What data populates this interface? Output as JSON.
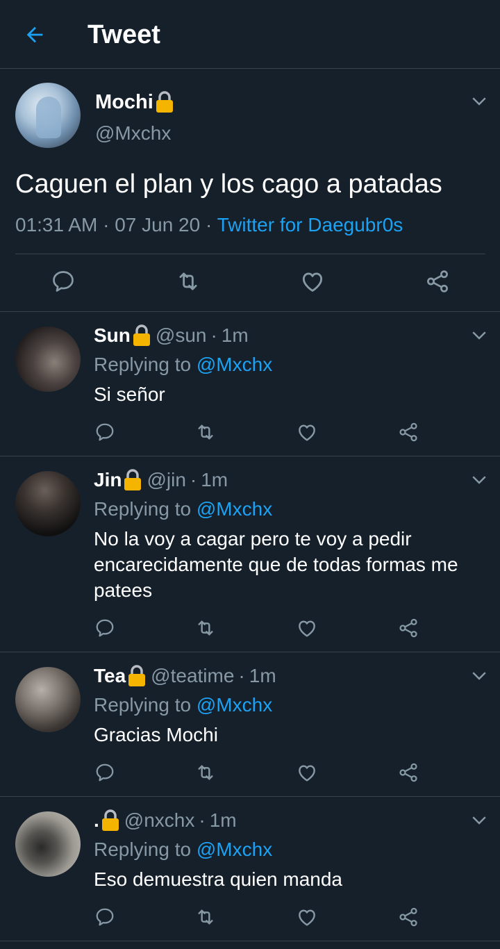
{
  "header": {
    "title": "Tweet"
  },
  "main_tweet": {
    "name": "Mochi",
    "handle": "@Mxchx",
    "text": "Caguen el plan y los cago a patadas",
    "time": "01:31 AM",
    "date": "07 Jun 20",
    "separator": "·",
    "source": "Twitter for Daegubr0s"
  },
  "replies": [
    {
      "name": "Sun",
      "handle": "@sun",
      "time": "1m",
      "replying_label": "Replying to",
      "mention": "@Mxchx",
      "text": "Si señor"
    },
    {
      "name": "Jin",
      "handle": "@jin",
      "time": "1m",
      "replying_label": "Replying to",
      "mention": "@Mxchx",
      "text": "No la voy a cagar pero te voy a pedir encarecidamente que de todas formas me patees"
    },
    {
      "name": "Tea",
      "handle": "@teatime",
      "time": "1m",
      "replying_label": "Replying to",
      "mention": "@Mxchx",
      "text": "Gracias Mochi"
    },
    {
      "name": ".",
      "handle": "@nxchx",
      "time": "1m",
      "replying_label": "Replying to",
      "mention": "@Mxchx",
      "text": "Eso demuestra quien manda"
    }
  ],
  "colors": {
    "background": "#15202b",
    "accent": "#1da1f2",
    "secondary_text": "#8899a6",
    "divider": "#38444d",
    "lock": "#f5b400"
  },
  "icons": [
    "back-arrow-icon",
    "lock-icon",
    "chevron-down-icon",
    "reply-icon",
    "retweet-icon",
    "like-icon",
    "share-icon"
  ]
}
